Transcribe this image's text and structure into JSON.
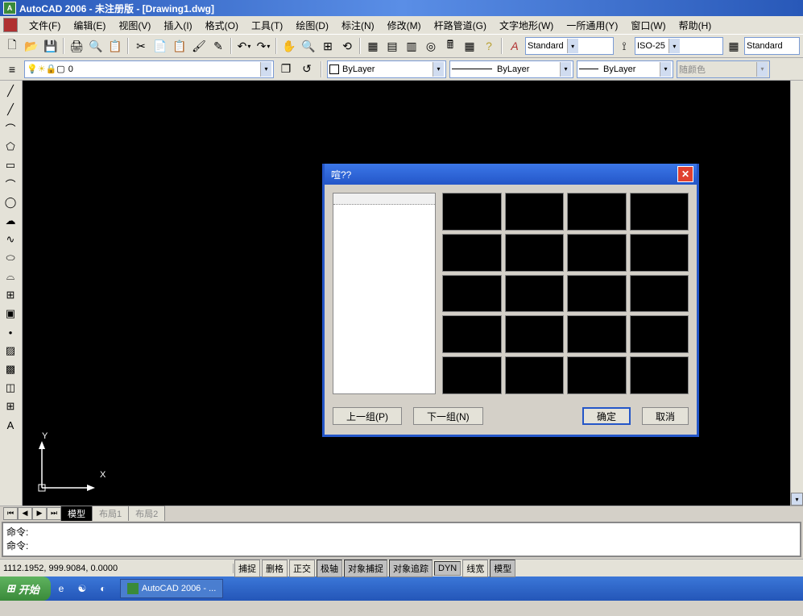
{
  "title": "AutoCAD 2006 - 未注册版 - [Drawing1.dwg]",
  "menu": [
    "文件(F)",
    "编辑(E)",
    "视图(V)",
    "插入(I)",
    "格式(O)",
    "工具(T)",
    "绘图(D)",
    "标注(N)",
    "修改(M)",
    "杆路管道(G)",
    "文字地形(W)",
    "一所通用(Y)",
    "窗口(W)",
    "帮助(H)"
  ],
  "styles": {
    "text_style": "Standard",
    "dim_style": "ISO-25",
    "table_style": "Standard"
  },
  "layers": {
    "current": "0"
  },
  "props": {
    "color": "ByLayer",
    "linetype": "ByLayer",
    "lineweight": "ByLayer",
    "plotstyle": "随颜色"
  },
  "layout_tabs": {
    "active": "模型",
    "others": [
      "布局1",
      "布局2"
    ]
  },
  "command": {
    "prompt1": "命令:",
    "prompt2": "命令:"
  },
  "status": {
    "coords": "1112.1952, 999.9084, 0.0000",
    "buttons": [
      "捕捉",
      "删格",
      "正交",
      "极轴",
      "对象捕捉",
      "对象追踪",
      "DYN",
      "线宽",
      "模型"
    ]
  },
  "taskbar": {
    "start": "开始",
    "app": "AutoCAD 2006 - ..."
  },
  "dialog": {
    "title": "喧??",
    "btn_prev": "上一组(P)",
    "btn_next": "下一组(N)",
    "btn_ok": "确定",
    "btn_cancel": "取消"
  },
  "ucs": {
    "x": "X",
    "y": "Y"
  }
}
